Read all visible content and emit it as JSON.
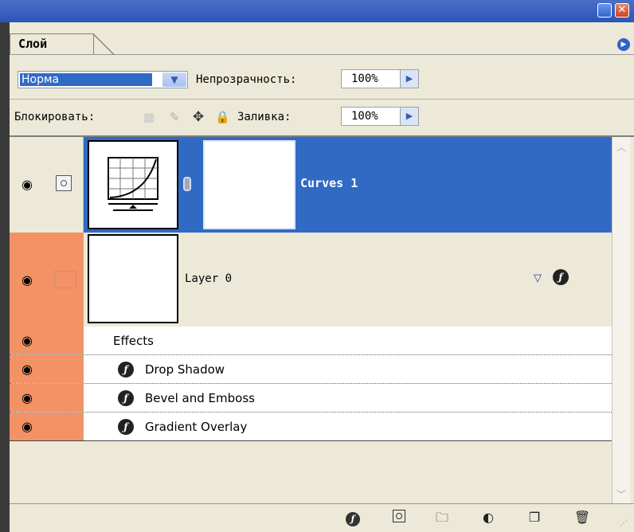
{
  "panel": {
    "tab_label": "Слой",
    "blend_mode": "Норма",
    "opacity_label": "Непрозрачность:",
    "opacity_value": "100%",
    "lock_label": "Блокировать:",
    "fill_label": "Заливка:",
    "fill_value": "100%"
  },
  "layers": [
    {
      "name": "Curves 1",
      "selected": true,
      "visible": true
    },
    {
      "name": "Layer 0",
      "selected": false,
      "visible": true,
      "effects_header": "Effects",
      "effects": [
        "Drop Shadow",
        "Bevel and Emboss",
        "Gradient Overlay"
      ]
    }
  ],
  "colors": {
    "selection": "#316ac5",
    "panel_bg": "#ece9d8",
    "eye_highlight": "#f39265",
    "title_bar": "#2a56b8"
  },
  "icons": {
    "lock_transparent": "checker-icon",
    "lock_image": "brush-icon",
    "lock_position": "move-icon",
    "lock_all": "lock-icon",
    "bottom": [
      "layer-style-icon",
      "add-mask-icon",
      "new-group-icon",
      "adjustment-layer-icon",
      "new-layer-icon",
      "trash-icon"
    ]
  }
}
